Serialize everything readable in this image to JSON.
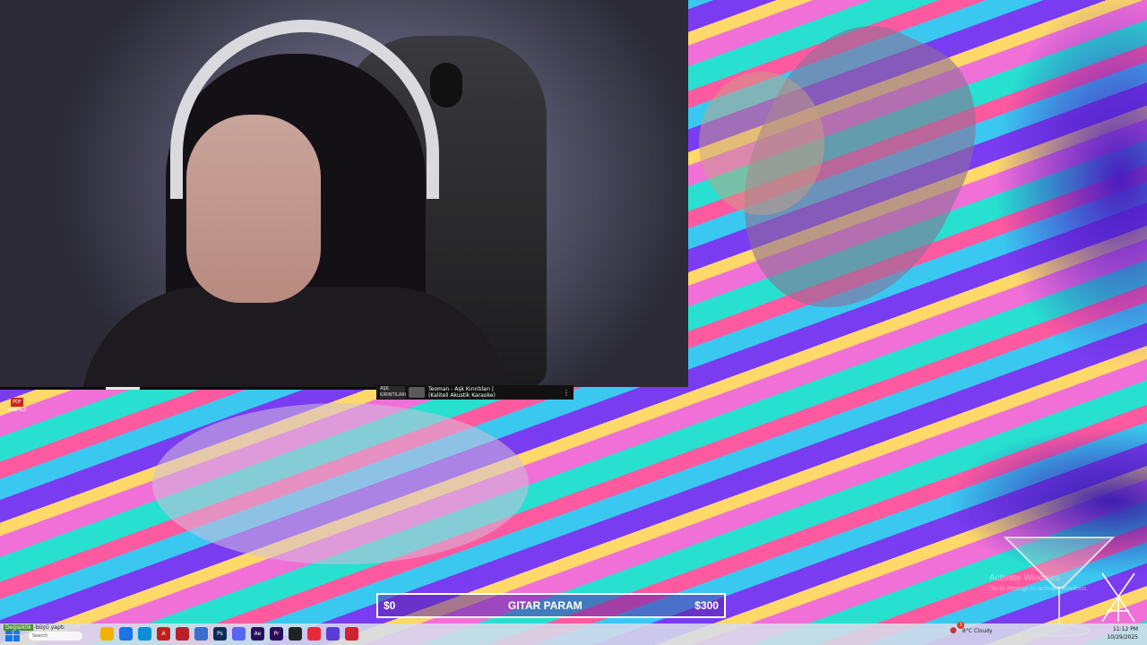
{
  "media": {
    "art_label": "AŞK KIRINTILARI",
    "title_line1": "Teoman - Aşk Kırıntıları |",
    "title_line2": "(Kaliteli Akustik Karaoke)",
    "more_icon": "more-vertical-icon"
  },
  "desktop_icon": {
    "badge": "PDF",
    "label": "menu2"
  },
  "goal": {
    "current": "$0",
    "title": "GITAR PARAM",
    "target": "$300",
    "progress_fraction": 0.0,
    "accent_color": "#5a28aa"
  },
  "watermark": {
    "line1": "Activate Windows",
    "line2": "Go to Settings to activate Windows."
  },
  "taskbar": {
    "weather_chip": "Değişiklik",
    "weather_text": "büyü yaptı",
    "search_placeholder": "Search",
    "apps": [
      {
        "name": "file-explorer-icon",
        "color": "#f2b300",
        "glyph": ""
      },
      {
        "name": "chrome-icon",
        "color": "#1a73e8",
        "glyph": ""
      },
      {
        "name": "edge-icon",
        "color": "#0a8fd8",
        "glyph": ""
      },
      {
        "name": "acrobat-icon",
        "color": "#c41e1e",
        "glyph": "A"
      },
      {
        "name": "app-red-icon",
        "color": "#b8202c",
        "glyph": ""
      },
      {
        "name": "app-blue-icon",
        "color": "#3a6fd0",
        "glyph": ""
      },
      {
        "name": "photoshop-icon",
        "color": "#0c2c5a",
        "glyph": "Ps"
      },
      {
        "name": "discord-icon",
        "color": "#5865f2",
        "glyph": ""
      },
      {
        "name": "after-effects-icon",
        "color": "#2a0e5a",
        "glyph": "Ae"
      },
      {
        "name": "premiere-icon",
        "color": "#2a0e5a",
        "glyph": "Pr"
      },
      {
        "name": "obs-icon",
        "color": "#222222",
        "glyph": ""
      },
      {
        "name": "opera-icon",
        "color": "#e8283a",
        "glyph": ""
      },
      {
        "name": "proton-vpn-icon",
        "color": "#5b3bd6",
        "glyph": ""
      },
      {
        "name": "app-red2-icon",
        "color": "#d42030",
        "glyph": ""
      }
    ],
    "tray_badge": "3",
    "temperature": "8°C",
    "weather_condition": "Cloudy",
    "time": "11:12 PM",
    "date": "10/29/2025"
  }
}
